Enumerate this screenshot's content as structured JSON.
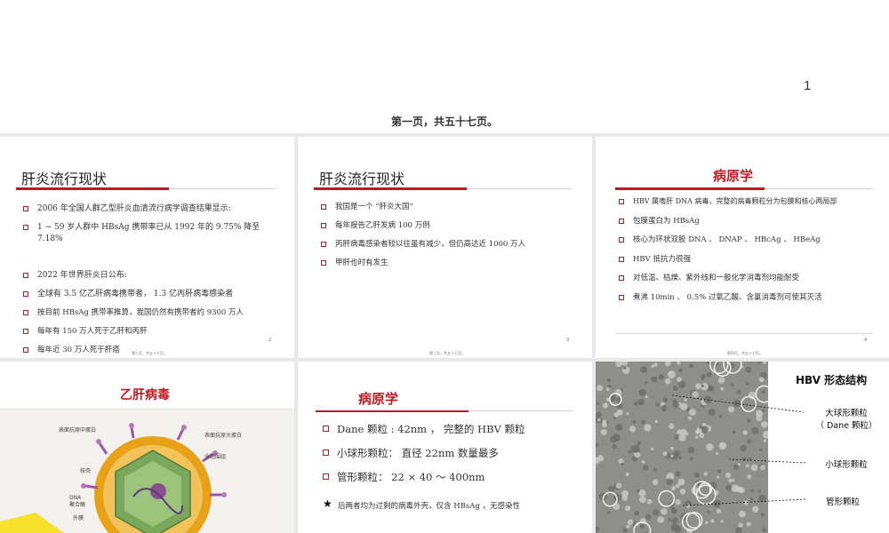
{
  "top": {
    "page_number": "1",
    "caption": "第一页，共五十七页。"
  },
  "slide1": {
    "title": "肝炎流行现状",
    "items": [
      "2006 年全国人群乙型肝炎血清流行病学调查结果显示:",
      "1 ~ 59 岁人群中 HBsAg 携带率已从 1992 年的 9.75% 降至 7.18%",
      "2022 年世界肝炎日公布:",
      "全球有 3.5 亿乙肝病毒携带者， 1.3 亿丙肝病毒感染者",
      "按目前 HBsAg 携带率推算，我国仍然有携带者约 9300 万人",
      "每年有 150 万人死于乙肝和丙肝",
      "每年近 30 万人死于肝癌"
    ],
    "page_no": "2",
    "footer": "第二页，共五十七页。"
  },
  "slide2": {
    "title": "肝炎流行现状",
    "items": [
      "我国是一个 “肝炎大国”",
      "每年报告乙肝发病 100 万例",
      "丙肝病毒感染者较以往虽有减少，但仍高达近 1000 万人",
      "甲肝也时有发生"
    ],
    "page_no": "3",
    "footer": "第三页，共五十七页。"
  },
  "slide3": {
    "title": "病原学",
    "items": [
      "HBV 属嗜肝 DNA 病毒，完整的病毒颗粒分为包膜和核心两局部",
      "包膜蛋白为 HBsAg",
      "核心为环状双股 DNA 、 DNAP 、 HBcAg 、  HBeAg",
      "HBV 抵抗力很强",
      "对低温、枯燥、紫外线和一般化学消毒剂均能耐受",
      "煮沸 10min 、 0.5% 过氧乙酸、含氯消毒剂可使其灭活"
    ],
    "page_no": "4",
    "footer": "第四页，共五十七页。"
  },
  "slide4": {
    "title": "乙肝病毒",
    "labels": {
      "surface_middle": "表面抗原中蛋白",
      "surface_large": "表面抗原大蛋白",
      "lipid": "含脂围组",
      "capsid": "核壳",
      "dna": "DNA\n聚合酶",
      "envelope": "外膜"
    }
  },
  "slide5": {
    "title": "病原学",
    "items": [
      "Dane 颗粒 : 42nm ， 完整的 HBV 颗粒",
      "小球形颗粒： 直径 22nm 数量最多",
      "管形颗粒：  22 × 40 ～ 400nm"
    ],
    "note": "后两者均为过剩的病毒外壳，仅含 HBsAg ，无感染性"
  },
  "slide6": {
    "title": "HBV 形态结构",
    "label_large": "大球形颗粒",
    "label_dane": "（ Dane 颗粒）",
    "label_small": "小球形颗粒",
    "label_tube": "管形颗粒"
  },
  "colors": {
    "accent_red": "#b81c22",
    "virus_yellow": "#e8a21a",
    "virus_green": "#79a85a",
    "virus_purple": "#8a4d8f"
  }
}
